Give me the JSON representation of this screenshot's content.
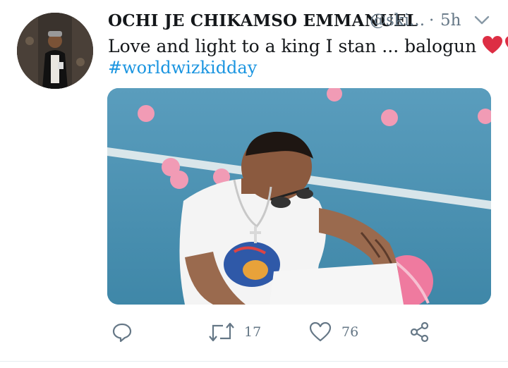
{
  "tweet": {
    "author_name": "OCHI JE CHIKAMSO EMMANUEL",
    "author_handle": "@ski...",
    "separator": "·",
    "time": "5h",
    "text": "Love and light to a king I stan ... balogun ",
    "text_end": ".",
    "hashtag": "#worldwizkidday"
  },
  "actions": {
    "retweets": "17",
    "likes": "76"
  },
  "colors": {
    "link": "#1b95e0",
    "muted": "#657786",
    "heart": "#e0245e"
  },
  "icons": [
    "avatar",
    "chevron-down-icon",
    "heart-emoji",
    "reply-icon",
    "retweet-icon",
    "like-icon",
    "share-icon"
  ]
}
